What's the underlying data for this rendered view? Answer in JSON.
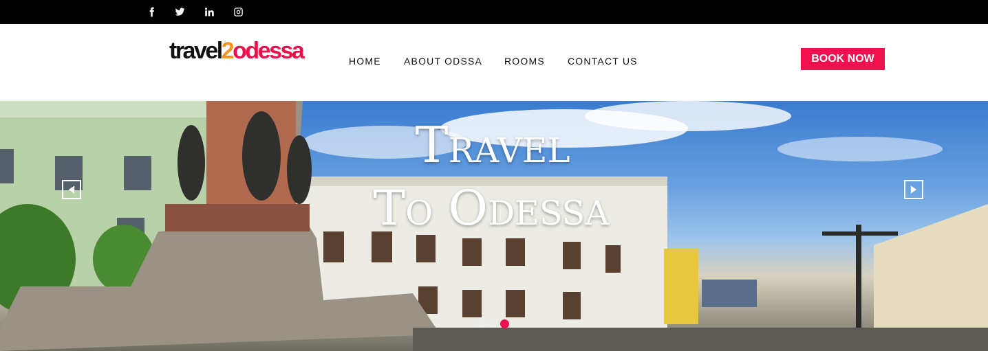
{
  "social": [
    {
      "icon": "facebook-icon",
      "glyph": "f"
    },
    {
      "icon": "twitter-icon"
    },
    {
      "icon": "linkedin-icon",
      "glyph": "in"
    },
    {
      "icon": "instagram-icon"
    }
  ],
  "logo": {
    "part1": "travel",
    "part2": "2",
    "part3": "odessa"
  },
  "nav": [
    "HOME",
    "ABOUT ODSSA",
    "ROOMS",
    "CONTACT US"
  ],
  "cta": {
    "label": "BOOK NOW",
    "color": "#f0104e"
  },
  "hero": {
    "line1": "Travel",
    "line2": "To Odessa",
    "slides": 3,
    "active_slide": 3,
    "prev_icon": "triangle-left-icon",
    "next_icon": "triangle-right-icon"
  },
  "colors": {
    "topbar": "#000000",
    "accent": "#f0104e",
    "logo_orange": "#f7941d"
  }
}
